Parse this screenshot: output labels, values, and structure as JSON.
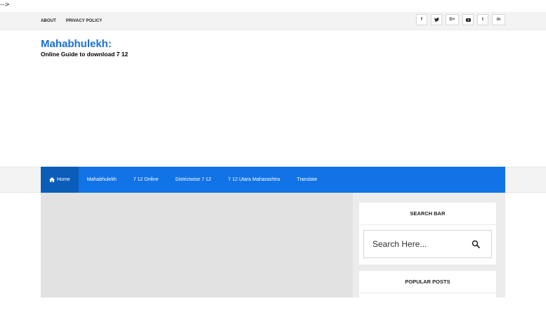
{
  "stray_text": "-->",
  "topbar": {
    "links": [
      "ABOUT",
      "PRIVACY POLICY"
    ],
    "social": [
      {
        "icon": "facebook-icon",
        "glyph": "f"
      },
      {
        "icon": "twitter-icon",
        "glyph": "🐦"
      },
      {
        "icon": "google-plus-icon",
        "glyph": "G+"
      },
      {
        "icon": "youtube-icon",
        "glyph": "▶"
      },
      {
        "icon": "tumblr-icon",
        "glyph": "t"
      },
      {
        "icon": "linkedin-icon",
        "glyph": "in"
      }
    ]
  },
  "brand": {
    "title": "Mahabhulekh:",
    "tagline": "Online Guide to download 7 12"
  },
  "nav": {
    "items": [
      "Home",
      "Mahabhulekh",
      "7 12 Online",
      "Districtwise 7 12",
      "7 12 Utara Maharashtra",
      "Translate"
    ],
    "active": 0
  },
  "sidebar": {
    "search_title": "SEARCH BAR",
    "search_placeholder": "Search Here...",
    "popular_title": "POPULAR POSTS"
  },
  "colors": {
    "accent": "#1273e6",
    "brand": "#1a6fd6"
  }
}
